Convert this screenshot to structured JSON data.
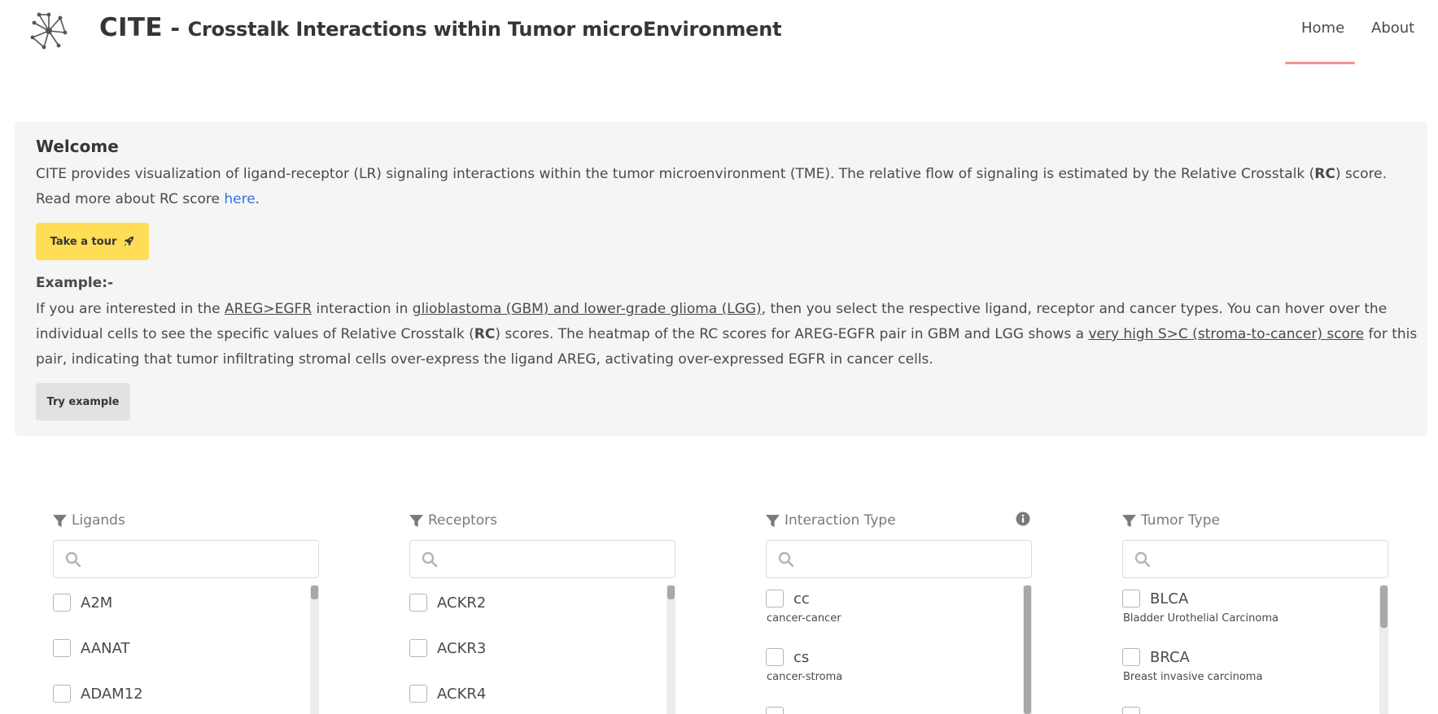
{
  "app": {
    "name": "CITE",
    "separator": "-",
    "subtitle": "Crosstalk Interactions within Tumor microEnvironment"
  },
  "nav": {
    "home": "Home",
    "about": "About",
    "active": "Home",
    "accent_color": "#f2958e"
  },
  "welcome": {
    "title": "Welcome",
    "intro_1": "CITE provides visualization of ligand-receptor (LR) signaling interactions within the tumor microenvironment (TME). The relative flow of signaling is estimated by the Relative Crosstalk (",
    "intro_bold": "RC",
    "intro_2": ") score. Read more about RC score ",
    "intro_link": "here",
    "intro_end": ".",
    "tour_button": "Take a tour",
    "tour_icon": "rocket-icon",
    "tour_color": "#ffdd57",
    "example_title": "Example:-",
    "example_1": "If you are interested in the ",
    "example_link_1": "AREG>EGFR",
    "example_2": " interaction in ",
    "example_link_2": "glioblastoma (GBM) and lower-grade glioma (LGG)",
    "example_3": ", then you select the respective ligand, receptor and cancer types. You can hover over the individual cells to see the specific values of Relative Crosstalk (",
    "example_bold": "RC",
    "example_4": ") scores. The heatmap of the RC scores for AREG-EGFR pair in GBM and LGG shows a ",
    "example_link_3": "very high S>C (stroma-to-cancer) score",
    "example_5": " for this pair, indicating that tumor infiltrating stromal cells over-express the ligand AREG, activating over-expressed EGFR in cancer cells.",
    "try_button": "Try example"
  },
  "filters": {
    "ligands": {
      "label": "Ligands",
      "search_value": "",
      "items": [
        "A2M",
        "AANAT",
        "ADAM12"
      ]
    },
    "receptors": {
      "label": "Receptors",
      "search_value": "",
      "items": [
        "ACKR2",
        "ACKR3",
        "ACKR4"
      ]
    },
    "interaction_type": {
      "label": "Interaction Type",
      "search_value": "",
      "items": [
        {
          "code": "cc",
          "desc": "cancer-cancer"
        },
        {
          "code": "cs",
          "desc": "cancer-stroma"
        }
      ]
    },
    "tumor_type": {
      "label": "Tumor Type",
      "search_value": "",
      "items": [
        {
          "code": "BLCA",
          "desc": "Bladder Urothelial Carcinoma"
        },
        {
          "code": "BRCA",
          "desc": "Breast invasive carcinoma"
        }
      ]
    }
  }
}
